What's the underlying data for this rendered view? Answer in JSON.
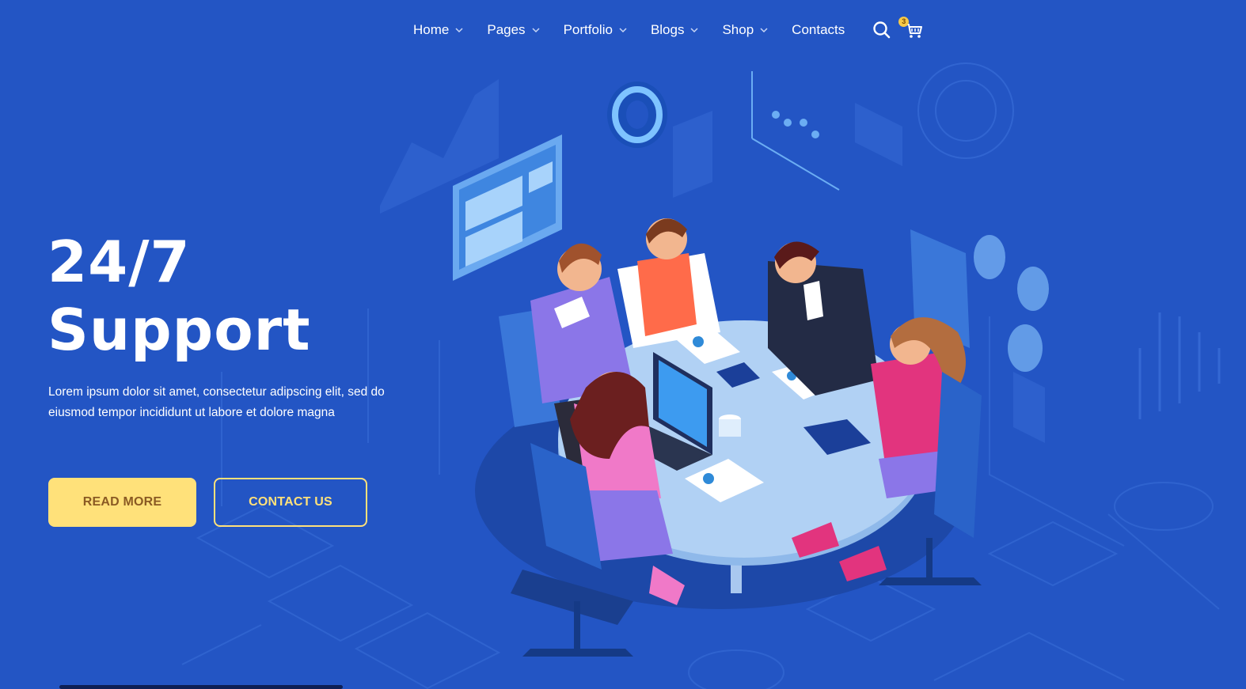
{
  "nav": {
    "items": [
      {
        "label": "Home",
        "has_dropdown": true
      },
      {
        "label": "Pages",
        "has_dropdown": true
      },
      {
        "label": "Portfolio",
        "has_dropdown": true
      },
      {
        "label": "Blogs",
        "has_dropdown": true
      },
      {
        "label": "Shop",
        "has_dropdown": true
      },
      {
        "label": "Contacts",
        "has_dropdown": false
      }
    ],
    "search_icon": "search-icon",
    "cart_icon": "cart-icon",
    "cart_count": "3"
  },
  "hero": {
    "title_line1": "24/7",
    "title_line2": "Support",
    "description": "Lorem ipsum dolor sit amet, consectetur adipscing elit, sed do eiusmod tempor incididunt ut labore et dolore magna",
    "read_more_label": "READ MORE",
    "contact_label": "CONTACT US"
  },
  "colors": {
    "background": "#2355c4",
    "accent_yellow": "#ffe17a",
    "button_text_brown": "#8a5a23"
  }
}
